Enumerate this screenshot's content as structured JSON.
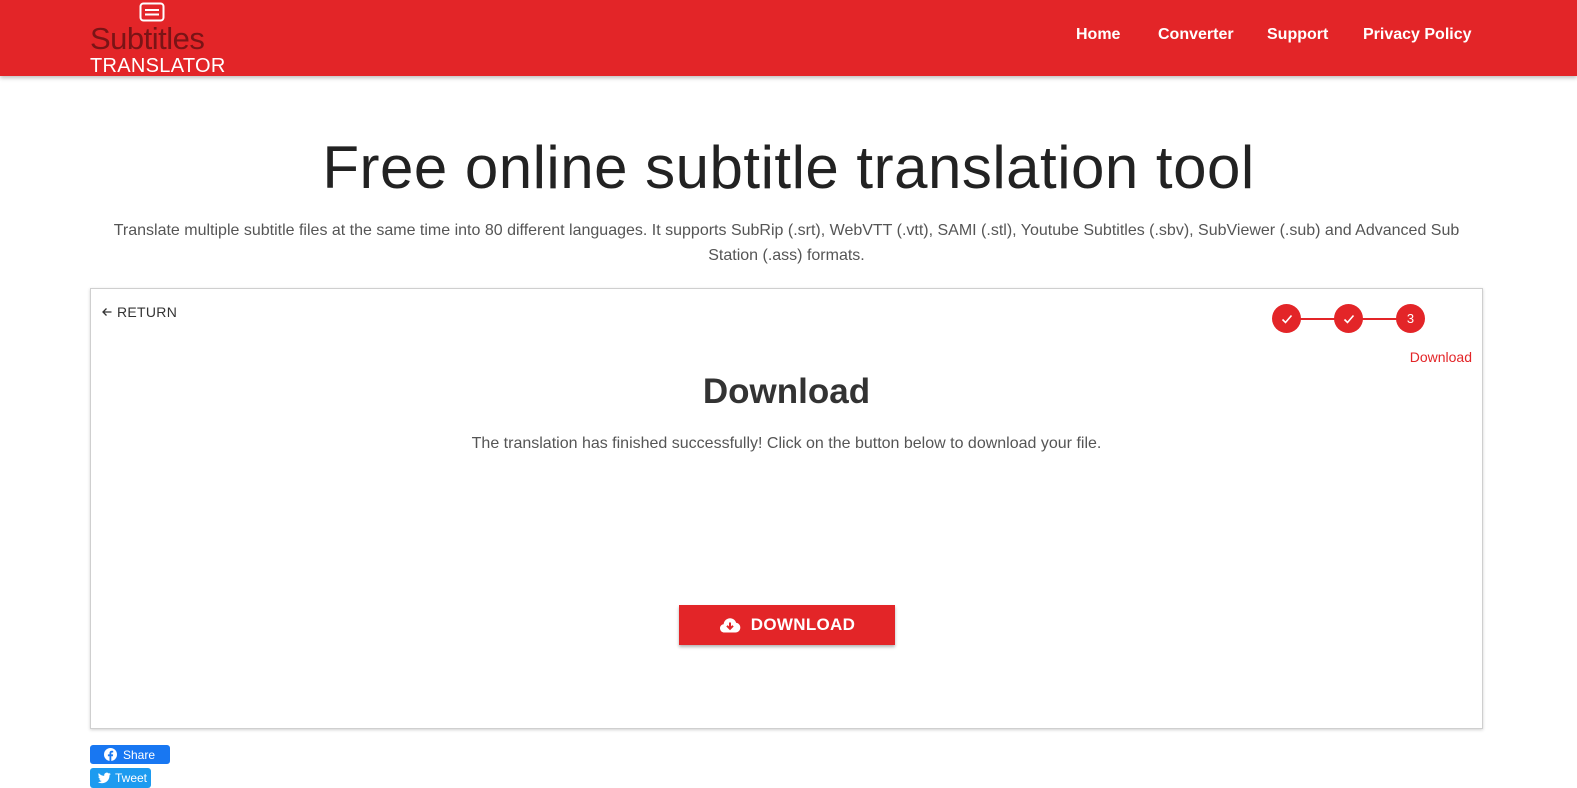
{
  "brand": {
    "line1": "Subtitles",
    "line2": "TRANSLATOR",
    "icon": "subtitles-icon",
    "color": "#e32528"
  },
  "nav": [
    {
      "label": "Home"
    },
    {
      "label": "Converter"
    },
    {
      "label": "Support"
    },
    {
      "label": "Privacy Policy"
    }
  ],
  "hero": {
    "title": "Free online subtitle translation tool",
    "subtitle": "Translate multiple subtitle files at the same time into 80 different languages. It supports SubRip (.srt), WebVTT (.vtt), SAMI (.stl), Youtube Subtitles (.sbv), SubViewer (.sub) and Advanced Sub Station (.ass) formats."
  },
  "card": {
    "return_label": "RETURN",
    "steps": [
      {
        "state": "done",
        "icon": "check-icon"
      },
      {
        "state": "done",
        "icon": "check-icon"
      },
      {
        "state": "active",
        "number": "3",
        "label": "Download"
      }
    ],
    "title": "Download",
    "message": "The translation has finished successfully! Click on the button below to download your file.",
    "download_label": "DOWNLOAD",
    "download_icon": "cloud-download-icon"
  },
  "social": {
    "share_label": "Share",
    "tweet_label": "Tweet",
    "facebook_color": "#1877f2",
    "twitter_color": "#1d9bf0"
  }
}
